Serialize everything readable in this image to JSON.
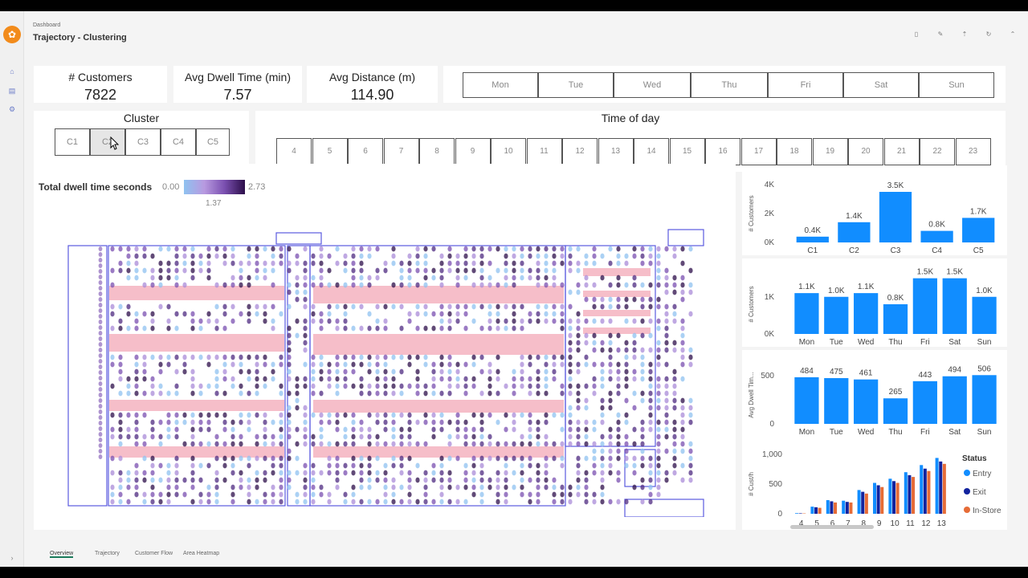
{
  "header": {
    "breadcrumb": "Dashboard",
    "title": "Trajectory - Clustering"
  },
  "kpis": [
    {
      "title": "# Customers",
      "value": "7822"
    },
    {
      "title": "Avg Dwell Time (min)",
      "value": "7.57"
    },
    {
      "title": "Avg Distance (m)",
      "value": "114.90"
    }
  ],
  "day_slicer": [
    "Mon",
    "Tue",
    "Wed",
    "Thu",
    "Fri",
    "Sat",
    "Sun"
  ],
  "cluster_slicer": {
    "title": "Cluster",
    "items": [
      "C1",
      "C2",
      "C3",
      "C4",
      "C5"
    ],
    "selected": "C2"
  },
  "time_slicer": {
    "title": "Time of day",
    "items": [
      "4",
      "5",
      "6",
      "7",
      "8",
      "9",
      "10",
      "11",
      "12",
      "13",
      "14",
      "15",
      "16",
      "17",
      "18",
      "19",
      "20",
      "21",
      "22",
      "23"
    ]
  },
  "heatmap": {
    "legend_title": "Total dwell time seconds",
    "min": "0.00",
    "mid": "1.37",
    "max": "2.73",
    "colors": {
      "low": "#8fc2f0",
      "mid": "#7a4fb0",
      "high": "#2c0e4a",
      "shelf": "#f5b3c0",
      "zone": "#5a5ae0"
    }
  },
  "chart_data": [
    {
      "type": "bar",
      "categories": [
        "C1",
        "C2",
        "C3",
        "C4",
        "C5"
      ],
      "values": [
        400,
        1400,
        3500,
        800,
        1700
      ],
      "data_labels": [
        "0.4K",
        "1.4K",
        "3.5K",
        "0.8K",
        "1.7K"
      ],
      "ylabel": "# Customers",
      "ylim": [
        0,
        4000
      ],
      "yticks": [
        "0K",
        "2K",
        "4K"
      ],
      "color": "#118dff"
    },
    {
      "type": "bar",
      "categories": [
        "Mon",
        "Tue",
        "Wed",
        "Thu",
        "Fri",
        "Sat",
        "Sun"
      ],
      "values": [
        1100,
        1000,
        1100,
        800,
        1500,
        1500,
        1000
      ],
      "data_labels": [
        "1.1K",
        "1.0K",
        "1.1K",
        "0.8K",
        "1.5K",
        "1.5K",
        "1.0K"
      ],
      "ylabel": "# Customers",
      "ylim": [
        0,
        1600
      ],
      "yticks": [
        "0K",
        "1K"
      ],
      "color": "#118dff"
    },
    {
      "type": "bar",
      "categories": [
        "Mon",
        "Tue",
        "Wed",
        "Thu",
        "Fri",
        "Sat",
        "Sun"
      ],
      "values": [
        484,
        475,
        461,
        265,
        443,
        494,
        506
      ],
      "data_labels": [
        "484",
        "475",
        "461",
        "265",
        "443",
        "494",
        "506"
      ],
      "ylabel": "Avg Dwell Tim...",
      "ylim": [
        0,
        600
      ],
      "yticks": [
        "0",
        "500"
      ],
      "color": "#118dff"
    },
    {
      "type": "bar",
      "categories": [
        "4",
        "5",
        "6",
        "7",
        "8",
        "9",
        "10",
        "11",
        "12",
        "13"
      ],
      "series": [
        {
          "name": "Entry",
          "values": [
            10,
            120,
            230,
            220,
            400,
            520,
            590,
            700,
            820,
            940
          ],
          "color": "#118dff"
        },
        {
          "name": "Exit",
          "values": [
            8,
            110,
            210,
            200,
            370,
            480,
            550,
            650,
            760,
            880
          ],
          "color": "#12239e"
        },
        {
          "name": "In-Store",
          "values": [
            6,
            100,
            190,
            190,
            340,
            450,
            520,
            620,
            720,
            840
          ],
          "color": "#e66c37"
        }
      ],
      "ylabel": "# Cust/h",
      "ylim": [
        0,
        1000
      ],
      "yticks": [
        "0",
        "500",
        "1,000"
      ],
      "legend_title": "Status",
      "legend_position": "right"
    }
  ],
  "bottom_tabs": [
    "Overview",
    "Trajectory",
    "Customer Flow",
    "Area Heatmap"
  ]
}
